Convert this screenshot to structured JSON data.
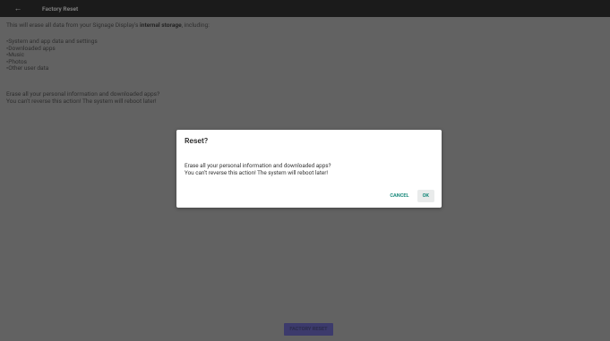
{
  "topbar": {
    "back_icon": "arrow-back-icon",
    "title": "Factory Reset"
  },
  "content": {
    "desc_prefix": "This will erase all data from your Signage Display's ",
    "desc_bold": "internal storage",
    "desc_suffix": ", including:",
    "bullets": [
      "System and app data and settings",
      "Downloaded apps",
      "Music",
      "Photos",
      "Other user data"
    ],
    "warn_line1": "Erase all your personal information and downloaded apps?",
    "warn_line2": "You can't reverse this action! The system will reboot later!"
  },
  "footer": {
    "reset_label": "FACTORY RESET"
  },
  "dialog": {
    "title": "Reset?",
    "msg_line1": "Erase all your personal information and downloaded apps?",
    "msg_line2": "You can't reverse this action! The system will reboot later!",
    "cancel_label": "CANCEL",
    "ok_label": "OK"
  },
  "colors": {
    "topbar_bg": "#1b1b1b",
    "scrim_bg": "#626262",
    "accent": "#1e8c7e",
    "button_bg": "#3c3a6c"
  }
}
